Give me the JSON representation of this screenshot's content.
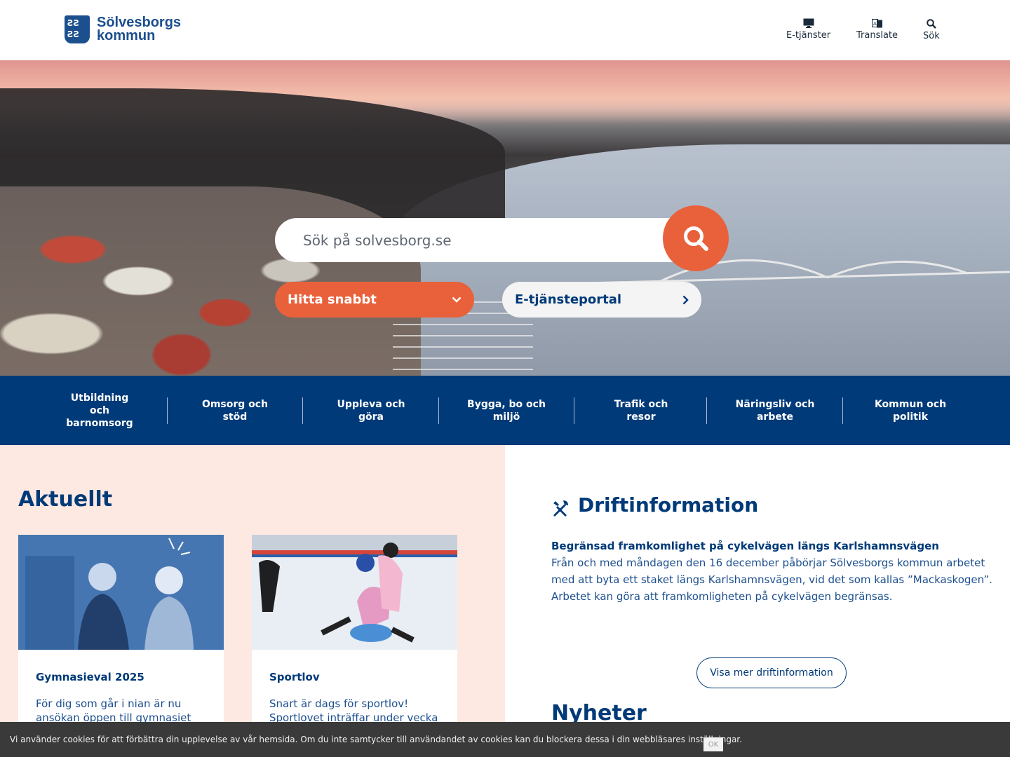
{
  "header": {
    "logo": {
      "line1": "Sölvesborgs",
      "line2": "kommun"
    },
    "links": [
      {
        "label": "E-tjänster",
        "icon": "monitor-icon"
      },
      {
        "label": "Translate",
        "icon": "translate-icon"
      },
      {
        "label": "Sök",
        "icon": "search-icon"
      }
    ]
  },
  "hero": {
    "search_placeholder": "Sök på solvesborg.se",
    "quick_label": "Hitta snabbt",
    "eportal_label": "E-tjänsteportal"
  },
  "nav": {
    "items": [
      {
        "label": "Utbildning och barnomsorg"
      },
      {
        "label": "Omsorg och stöd"
      },
      {
        "label": "Uppleva och göra"
      },
      {
        "label": "Bygga, bo och miljö"
      },
      {
        "label": "Trafik och resor"
      },
      {
        "label": "Näringsliv och arbete"
      },
      {
        "label": "Kommun och politik"
      }
    ]
  },
  "aktuellt": {
    "title": "Aktuellt",
    "cards": [
      {
        "title": "Gymnasieval 2025",
        "text": "För dig som går i nian är nu ansökan öppen till gymnasiet"
      },
      {
        "title": "Sportlov",
        "text": "Snart är dags för sportlov! Sportlovet inträffar under vecka"
      }
    ]
  },
  "drift": {
    "title": "Driftinformation",
    "headline": "Begränsad framkomlighet på cykelvägen längs Karlshamnsvägen",
    "body": "Från och med måndagen den 16 december påbörjar Sölvesborgs kommun arbetet med att byta ett staket längs Karlshamnsvägen, vid det som kallas ”Mackaskogen”. Arbetet kan göra att framkomligheten på cykelvägen begränsas.",
    "more_label": "Visa mer driftinformation"
  },
  "nyheter": {
    "title": "Nyheter"
  },
  "cookie": {
    "text": "Vi använder cookies för att förbättra din upplevelse av vår hemsida. Om du inte samtycker till användandet av cookies kan du blockera dessa i din webbläsares inställningar.",
    "ok_label": "OK"
  },
  "colors": {
    "primary": "#003a78",
    "accent": "#e8613b",
    "panel": "#fde9e2"
  }
}
